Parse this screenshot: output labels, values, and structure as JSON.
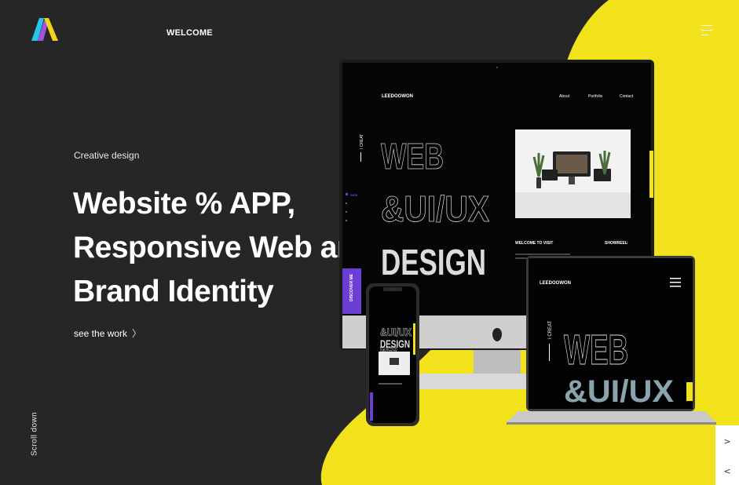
{
  "nav": {
    "welcome_label": "WELCOME",
    "menu_label": "MENU"
  },
  "hero": {
    "eyebrow": "Creative design",
    "headline": [
      "Website % APP,",
      "Responsive Web and",
      "Brand Identity"
    ],
    "cta_label": "see the work",
    "scroll_label": "Scroll down"
  },
  "mockup": {
    "brand": "LEEDOOWON",
    "nav_links": [
      "About",
      "Portfolio",
      "Contact"
    ],
    "side_label": "I CREAT",
    "big_lines": [
      "WEB",
      "&UI/UX",
      "DESIGN"
    ],
    "welcome_visit": "WELCOME TO VISIT",
    "showreel": "SHOWREEL",
    "discover": "DISCOVER ME",
    "side_dot_label": "WEB",
    "laptop_big": [
      "WEB",
      "&UI/UX"
    ]
  },
  "slider": {
    "next_icon": ">",
    "prev_icon": "<"
  },
  "colors": {
    "background": "#262626",
    "accent_yellow": "#f2e21b",
    "accent_purple": "#6b3fd6"
  }
}
